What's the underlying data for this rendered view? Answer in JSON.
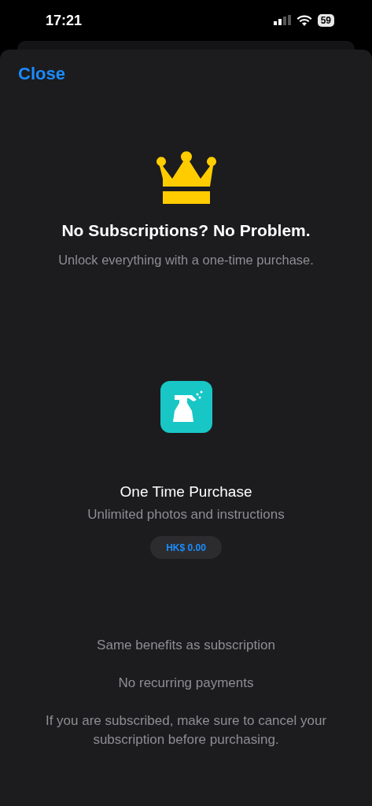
{
  "status_bar": {
    "time": "17:21",
    "battery": "59"
  },
  "nav": {
    "close": "Close"
  },
  "header": {
    "title": "No Subscriptions? No Problem.",
    "subtitle": "Unlock everything with a one-time purchase."
  },
  "product": {
    "title": "One Time Purchase",
    "description": "Unlimited photos and instructions",
    "price": "HK$ 0.00"
  },
  "notes": [
    "Same benefits as subscription",
    "No recurring payments",
    "If you are subscribed, make sure to cancel your subscription before purchasing."
  ]
}
